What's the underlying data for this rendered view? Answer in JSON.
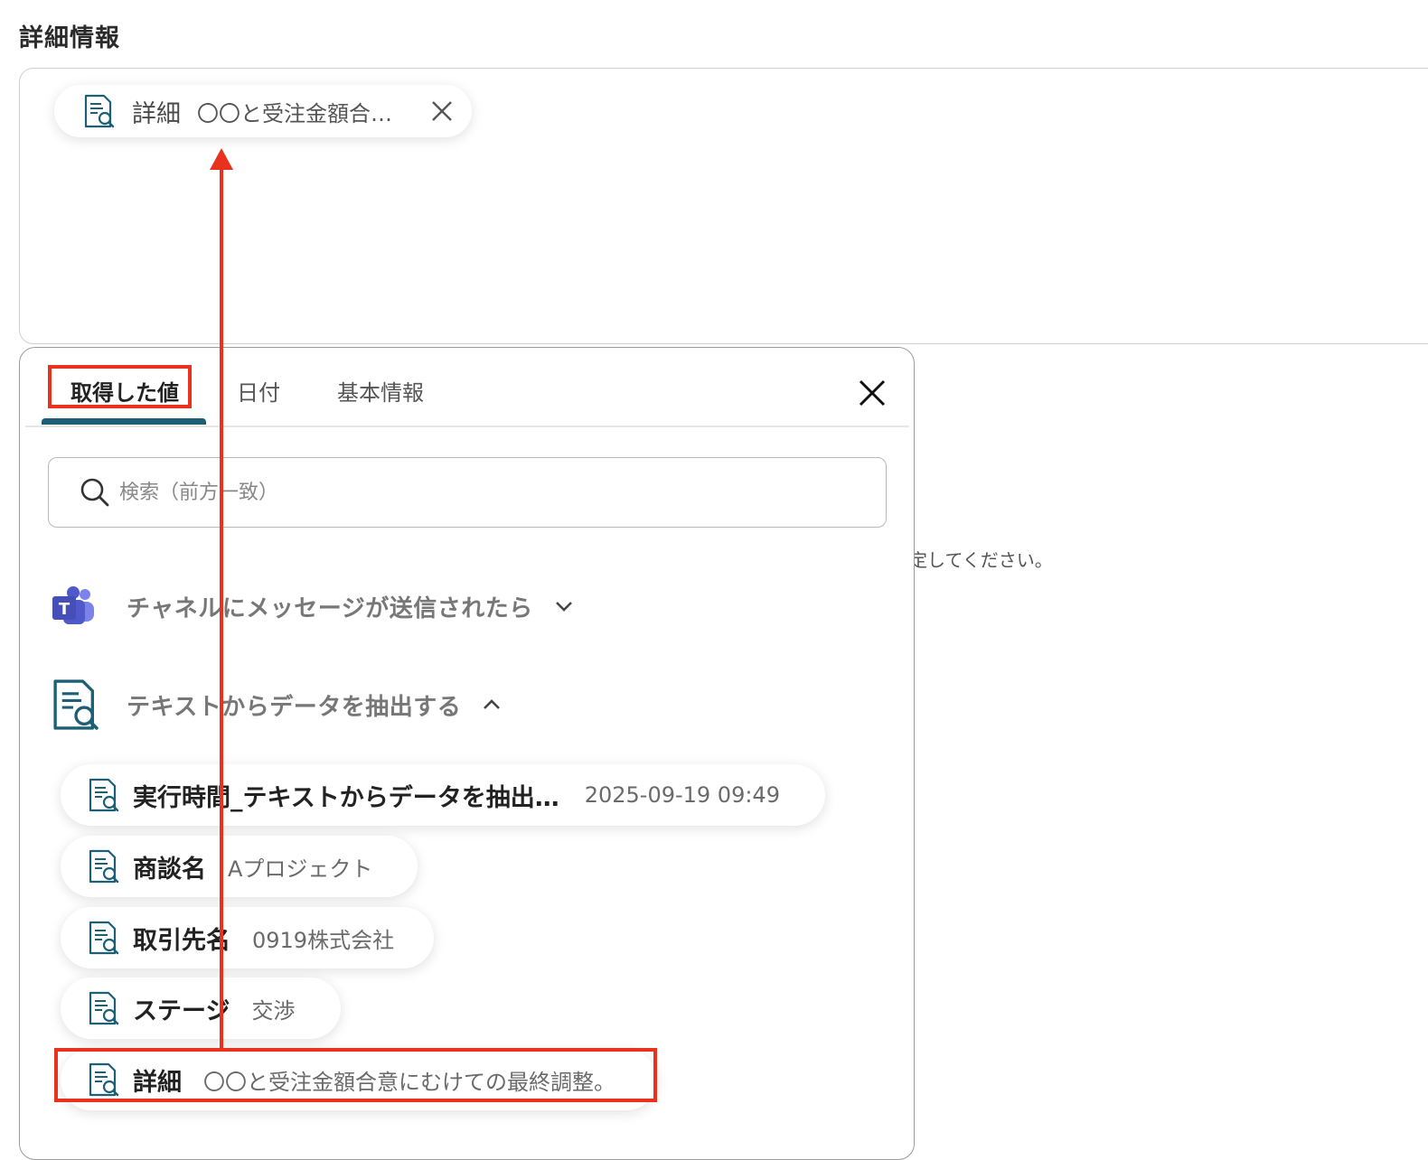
{
  "section": {
    "title": "詳細情報"
  },
  "field": {
    "chip": {
      "key": "詳細",
      "value": "〇〇と受注金額合…"
    }
  },
  "background": {
    "hint": "定してください。"
  },
  "panel": {
    "tabs": [
      {
        "label": "取得した値",
        "active": true
      },
      {
        "label": "日付",
        "active": false
      },
      {
        "label": "基本情報",
        "active": false
      }
    ],
    "search": {
      "placeholder": "検索（前方一致）",
      "value": ""
    },
    "groups": [
      {
        "title": "チャネルにメッセージが送信されたら",
        "icon": "teams-icon",
        "expanded": false
      },
      {
        "title": "テキストからデータを抽出する",
        "icon": "document-search-icon",
        "expanded": true
      }
    ],
    "items": [
      {
        "key": "実行時間_テキストからデータを抽出…",
        "value": "2025-09-19 09:49"
      },
      {
        "key": "商談名",
        "value": "Aプロジェクト"
      },
      {
        "key": "取引先名",
        "value": "0919株式会社"
      },
      {
        "key": "ステージ",
        "value": "交渉"
      },
      {
        "key": "詳細",
        "value": "〇〇と受注金額合意にむけての最終調整。"
      }
    ]
  },
  "colors": {
    "accent": "#1d5f75",
    "highlight": "#e8321e",
    "teams": "#5059c9"
  }
}
